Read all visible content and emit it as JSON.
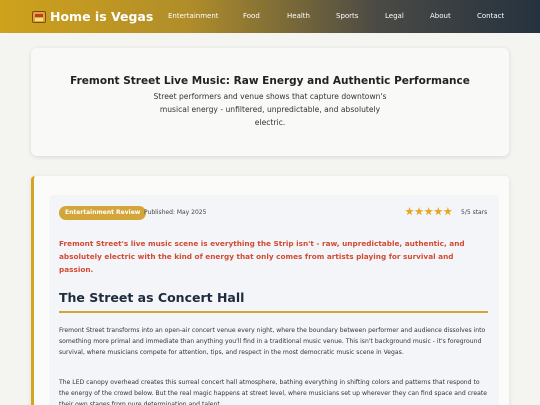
{
  "nav": {
    "brand": "Home is Vegas",
    "brand_icon": "slot-machine-icon",
    "links": [
      "Entertainment",
      "Food",
      "Health",
      "Sports",
      "Legal",
      "About",
      "Contact"
    ]
  },
  "hero": {
    "title": "Fremont Street Live Music: Raw Energy and Authentic Performance",
    "subtitle": "Street performers and venue shows that capture downtown's musical energy - unfiltered, unpredictable, and absolutely electric."
  },
  "article": {
    "category": "Entertainment Review",
    "published": "Published: May 2025",
    "rating": {
      "value": 5,
      "max": 5,
      "text": "5/5 stars"
    },
    "lead": "Fremont Street's live music scene is everything the Strip isn't - raw, unpredictable, authentic, and absolutely electric with the kind of energy that only comes from artists playing for survival and passion.",
    "heading": "The Street as Concert Hall",
    "paragraphs": [
      "Fremont Street transforms into an open-air concert venue every night, where the boundary between performer and audience dissolves into something more primal and immediate than anything you'll find in a traditional music venue. This isn't background music - it's foreground survival, where musicians compete for attention, tips, and respect in the most democratic music scene in Vegas.",
      "The LED canopy overhead creates this surreal concert hall atmosphere, bathing everything in shifting colors and patterns that respond to the energy of the crowd below. But the real magic happens at street level, where musicians set up wherever they can find space and create their own stages from pure determination and talent."
    ]
  },
  "colors": {
    "accent_gold": "#d4a520",
    "lead_red": "#d24a33",
    "star": "#e9a51c",
    "heading": "#1f2a3d"
  }
}
